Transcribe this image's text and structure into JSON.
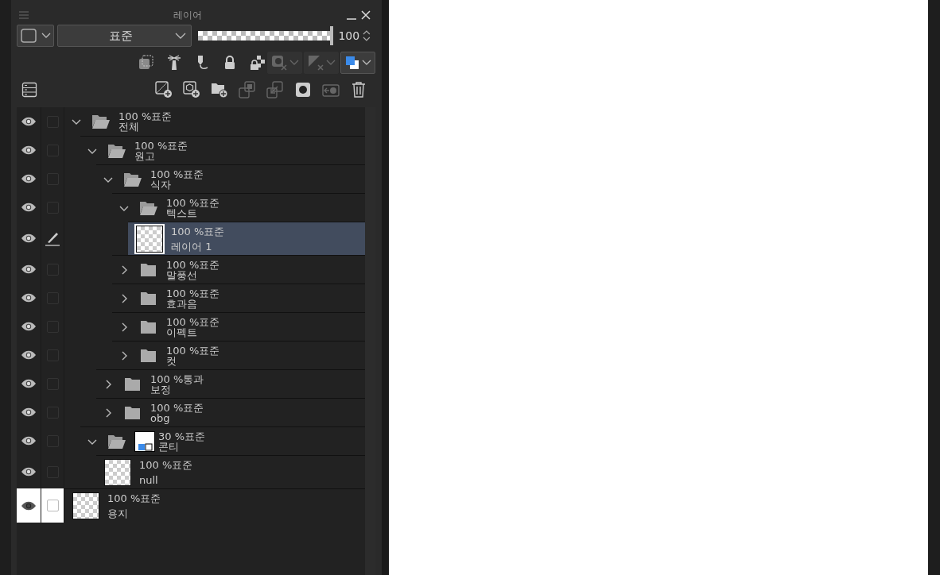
{
  "panel": {
    "title": "레이어",
    "blend_mode": "표준",
    "opacity": {
      "level": 1,
      "reading": "100"
    },
    "tools": [
      {
        "kind": "clip",
        "disabled": false
      },
      {
        "kind": "reference",
        "disabled": false
      },
      {
        "kind": "draft",
        "disabled": false
      },
      {
        "kind": "lock",
        "disabled": false
      },
      {
        "kind": "lock-alpha",
        "disabled": false
      },
      {
        "kind": "mask-menu",
        "disabled": true
      },
      {
        "kind": "ruler-menu",
        "disabled": true
      },
      {
        "kind": "color-menu",
        "disabled": false
      }
    ],
    "actions": [
      {
        "kind": "new-raster",
        "disabled": false
      },
      {
        "kind": "new-vector",
        "disabled": false
      },
      {
        "kind": "new-folder",
        "disabled": false
      },
      {
        "kind": "transfer",
        "disabled": true
      },
      {
        "kind": "merge",
        "disabled": true
      },
      {
        "kind": "mask",
        "disabled": false
      },
      {
        "kind": "apply-mask",
        "disabled": true
      },
      {
        "kind": "delete",
        "disabled": false
      }
    ],
    "layers": [
      {
        "kind": "folder",
        "mode": "100 %표준",
        "name": "전체",
        "visible": true,
        "checked": false,
        "expanded": true,
        "selected": false,
        "children": [
          {
            "kind": "folder",
            "mode": "100 %표준",
            "name": "원고",
            "visible": true,
            "checked": false,
            "expanded": true,
            "selected": false,
            "children": [
              {
                "kind": "folder",
                "mode": "100 %표준",
                "name": "식자",
                "visible": true,
                "checked": false,
                "expanded": true,
                "selected": false,
                "children": [
                  {
                    "kind": "folder",
                    "mode": "100 %표준",
                    "name": "텍스트",
                    "visible": true,
                    "checked": false,
                    "expanded": true,
                    "selected": false,
                    "children": [
                      {
                        "kind": "raster",
                        "mode": "100 %표준",
                        "name": "레이어 1",
                        "visible": true,
                        "selected": true
                      }
                    ]
                  },
                  {
                    "kind": "folder",
                    "mode": "100 %표준",
                    "name": "말풍선",
                    "visible": true,
                    "checked": false,
                    "expanded": false,
                    "selected": false
                  },
                  {
                    "kind": "folder",
                    "mode": "100 %표준",
                    "name": "효과음",
                    "visible": true,
                    "checked": false,
                    "expanded": false,
                    "selected": false
                  },
                  {
                    "kind": "folder",
                    "mode": "100 %표준",
                    "name": "이펙트",
                    "visible": true,
                    "checked": false,
                    "expanded": false,
                    "selected": false
                  },
                  {
                    "kind": "folder",
                    "mode": "100 %표준",
                    "name": "컷",
                    "visible": true,
                    "checked": false,
                    "expanded": false,
                    "selected": false
                  }
                ]
              },
              {
                "kind": "folder",
                "mode": "100 %통과",
                "name": "보정",
                "visible": true,
                "checked": false,
                "expanded": false,
                "selected": false
              },
              {
                "kind": "folder",
                "mode": "100 %표준",
                "name": "obg",
                "visible": true,
                "checked": false,
                "expanded": false,
                "selected": false
              }
            ]
          },
          {
            "kind": "folder-mask",
            "mode": "30 %표준",
            "name": "콘티",
            "visible": true,
            "checked": false,
            "expanded": true,
            "selected": false,
            "children": [
              {
                "kind": "raster",
                "mode": "100 %표준",
                "name": "null",
                "visible": true,
                "checked": false,
                "selected": false
              }
            ]
          }
        ]
      },
      {
        "kind": "paper",
        "mode": "100 %표준",
        "name": "용지",
        "visible": true,
        "checked": false,
        "selected": false
      }
    ]
  }
}
